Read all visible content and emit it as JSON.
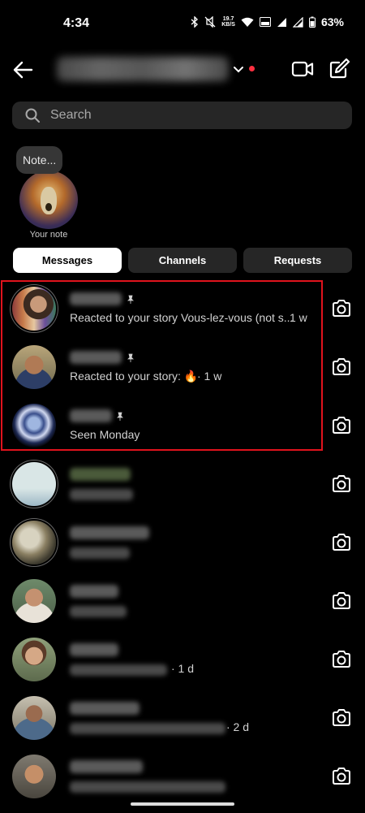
{
  "status_bar": {
    "time": "4:34",
    "net_speed_value": "19.7",
    "net_speed_unit": "KB/S",
    "battery": "63%"
  },
  "header": {
    "back_icon": "arrow-left-icon",
    "chevron_icon": "chevron-down-icon",
    "video_icon": "video-camera-icon",
    "compose_icon": "compose-icon",
    "notification_dot_color": "#ff3040"
  },
  "search": {
    "placeholder": "Search",
    "value": ""
  },
  "note": {
    "bubble_text": "Note...",
    "label": "Your note"
  },
  "tabs": [
    {
      "label": "Messages",
      "active": true
    },
    {
      "label": "Channels",
      "active": false
    },
    {
      "label": "Requests",
      "active": false
    }
  ],
  "highlight_color": "#e0131d",
  "conversations": [
    {
      "pinned": true,
      "preview": "Reacted to your story Vous-lez-vous (not s...",
      "suffix": "1 w"
    },
    {
      "pinned": true,
      "preview": "Reacted to your story: 🔥",
      "suffix": "· 1 w"
    },
    {
      "pinned": true,
      "preview": "Seen Monday",
      "suffix": ""
    },
    {
      "pinned": false,
      "preview": "",
      "suffix": ""
    },
    {
      "pinned": false,
      "preview": "",
      "suffix": ""
    },
    {
      "pinned": false,
      "preview": "",
      "suffix": ""
    },
    {
      "pinned": false,
      "preview": "",
      "suffix": "· 1 d"
    },
    {
      "pinned": false,
      "preview": "",
      "suffix": "· 2 d"
    },
    {
      "pinned": false,
      "preview": "",
      "suffix": ""
    }
  ]
}
